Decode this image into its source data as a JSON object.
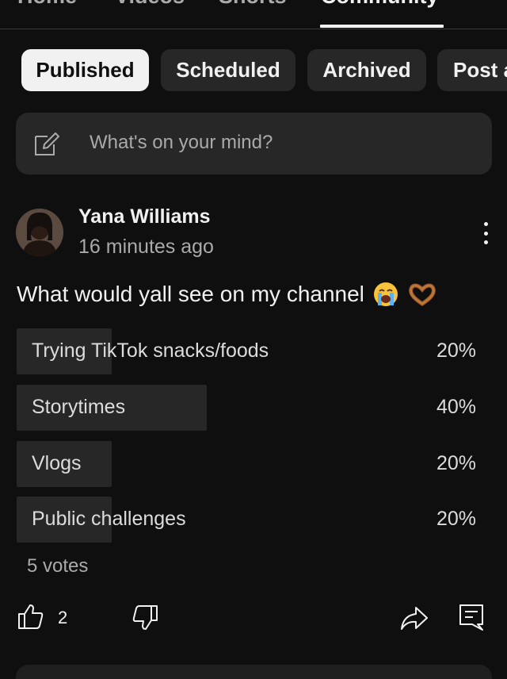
{
  "top_tabs": [
    {
      "label": "Home"
    },
    {
      "label": "Videos"
    },
    {
      "label": "Shorts"
    },
    {
      "label": "Community",
      "active": true
    }
  ],
  "chips": [
    {
      "label": "Published",
      "active": true
    },
    {
      "label": "Scheduled"
    },
    {
      "label": "Archived"
    },
    {
      "label": "Post a"
    }
  ],
  "composer": {
    "placeholder": "What's on your mind?",
    "icon": "edit-icon"
  },
  "post": {
    "author": "Yana Williams",
    "time": "16 minutes ago",
    "text": "What would yall see on my channel",
    "emojis": [
      "loudly-crying-face",
      "heart-hands"
    ],
    "poll": {
      "options": [
        {
          "label": "Trying TikTok snacks/foods",
          "percent_label": "20%",
          "share": 0.2
        },
        {
          "label": "Storytimes",
          "percent_label": "40%",
          "share": 0.4
        },
        {
          "label": "Vlogs",
          "percent_label": "20%",
          "share": 0.2
        },
        {
          "label": "Public challenges",
          "percent_label": "20%",
          "share": 0.2
        }
      ],
      "votes": "5 votes"
    },
    "actions": {
      "like_count": "2",
      "icons": [
        "thumbs-up-icon",
        "thumbs-down-icon",
        "share-icon",
        "comment-icon",
        "more-vert-icon"
      ]
    }
  },
  "colors": {
    "background": "#0f0f0f",
    "surface": "#272727",
    "text": "#f1f1f1",
    "muted": "#aaaaaa"
  }
}
